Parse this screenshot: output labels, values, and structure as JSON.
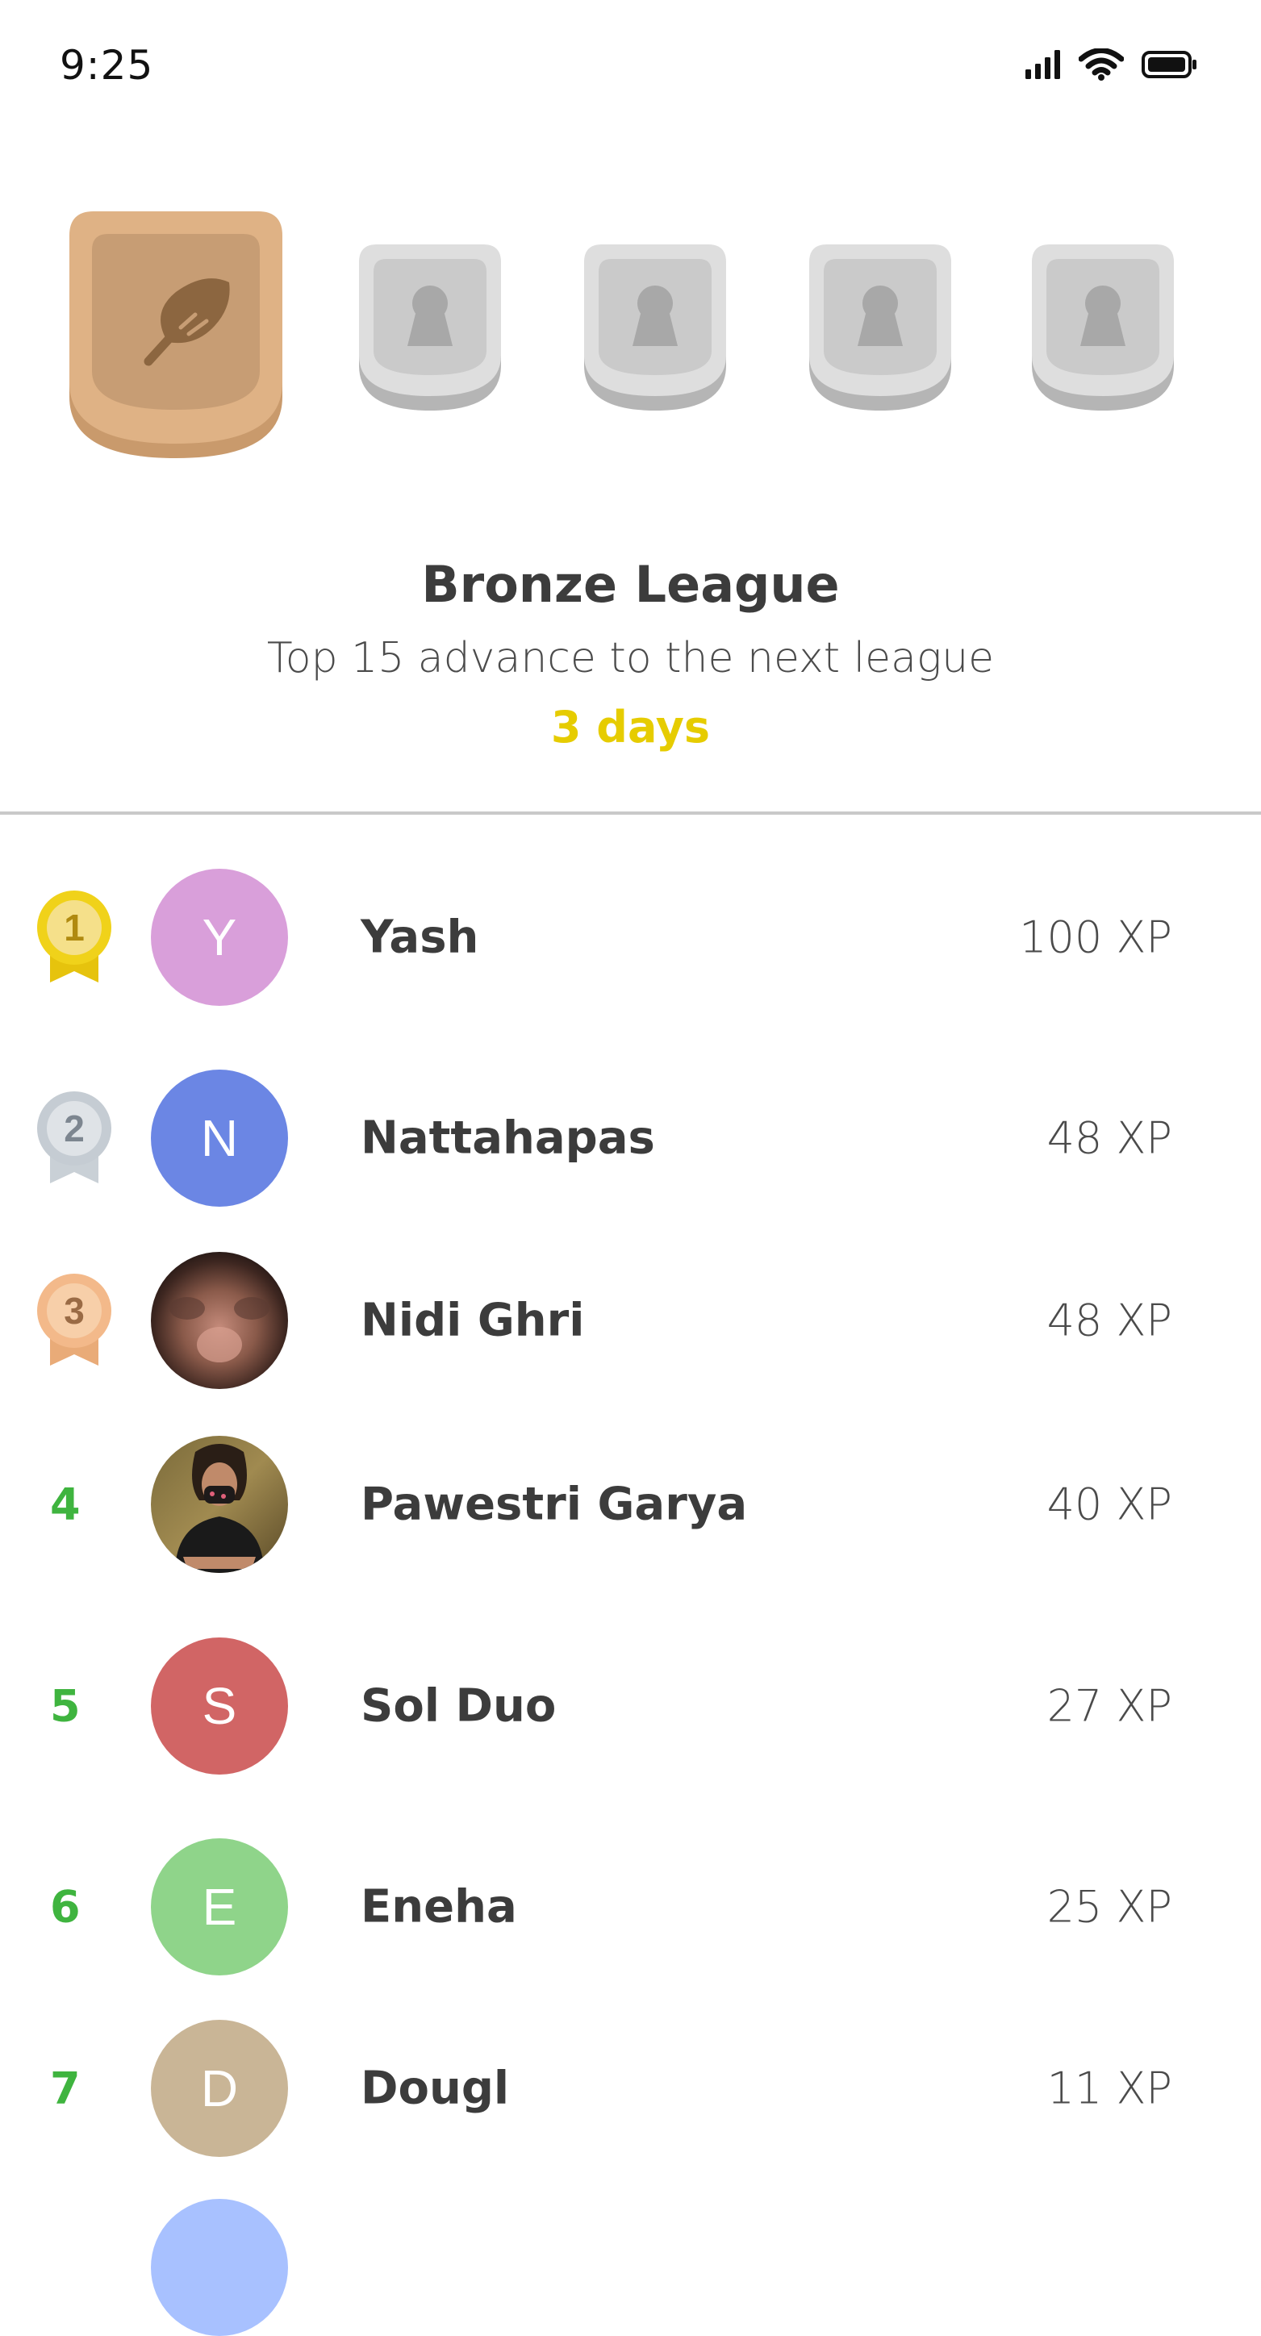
{
  "status_bar": {
    "time": "9:25"
  },
  "league": {
    "title": "Bronze League",
    "subtitle": "Top 15 advance to the next league",
    "timer": "3 days",
    "shields": [
      {
        "name": "bronze",
        "state": "current",
        "icon": "feather-icon",
        "color": "#dcae82"
      },
      {
        "name": "locked",
        "state": "locked",
        "icon": "keyhole-icon",
        "color": "#dcdcdc"
      },
      {
        "name": "locked",
        "state": "locked",
        "icon": "keyhole-icon",
        "color": "#dcdcdc"
      },
      {
        "name": "locked",
        "state": "locked",
        "icon": "keyhole-icon",
        "color": "#dcdcdc"
      },
      {
        "name": "locked",
        "state": "locked",
        "icon": "keyhole-icon",
        "color": "#dcdcdc"
      }
    ]
  },
  "leaderboard": {
    "rows": [
      {
        "rank": "1",
        "medal": "gold",
        "initial": "Y",
        "avatar_color": "#d99fda",
        "name": "Yash",
        "xp": "100 XP"
      },
      {
        "rank": "2",
        "medal": "silver",
        "initial": "N",
        "avatar_color": "#6b86e4",
        "name": "Nattahapas",
        "xp": "48 XP"
      },
      {
        "rank": "3",
        "medal": "bronze",
        "initial": "",
        "avatar_color": "#6b4a3e",
        "name": "Nidi Ghri",
        "xp": "48 XP"
      },
      {
        "rank": "4",
        "medal": "",
        "initial": "",
        "avatar_color": "#5a4a2a",
        "name": "Pawestri Garya",
        "xp": "40 XP"
      },
      {
        "rank": "5",
        "medal": "",
        "initial": "S",
        "avatar_color": "#d16565",
        "name": "Sol Duo",
        "xp": "27 XP"
      },
      {
        "rank": "6",
        "medal": "",
        "initial": "E",
        "avatar_color": "#8fd48a",
        "name": "Eneha",
        "xp": "25 XP"
      },
      {
        "rank": "7",
        "medal": "",
        "initial": "D",
        "avatar_color": "#c9b596",
        "name": "Dougl",
        "xp": "11 XP"
      },
      {
        "rank": "",
        "medal": "",
        "initial": "",
        "avatar_color": "#a8c1ff",
        "name": "",
        "xp": ""
      }
    ]
  },
  "colors": {
    "rank_green": "#3fb43f",
    "timer_yellow": "#e6cc00",
    "gold": "#f0d21a",
    "silver": "#c5ccd3",
    "bronze": "#f3b98a"
  }
}
